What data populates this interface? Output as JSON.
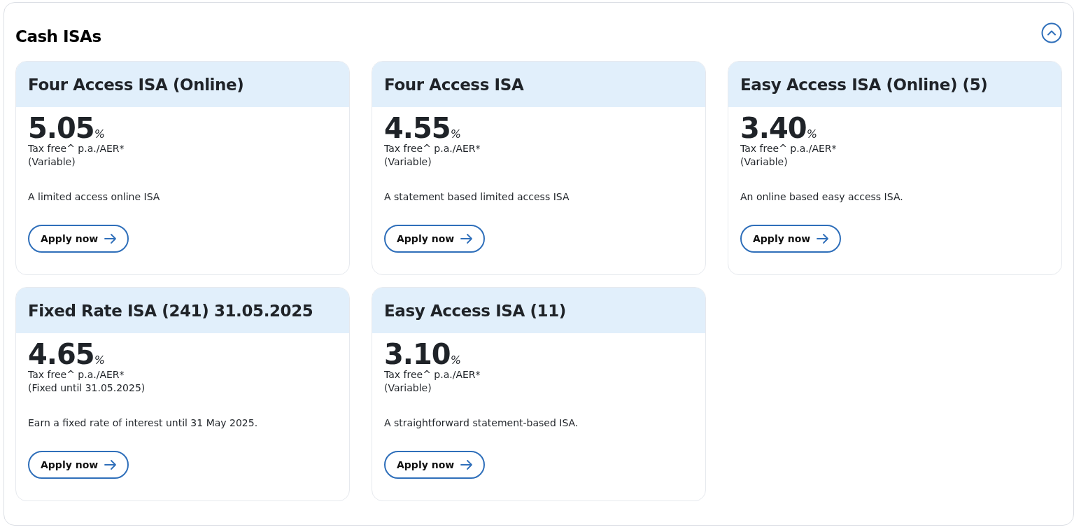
{
  "section": {
    "title": "Cash ISAs",
    "expanded": true
  },
  "products": [
    {
      "name": "Four Access ISA (Online)",
      "rate": "5.05",
      "unit": "%",
      "basis": "Tax free^ p.a./AER*",
      "rate_type": "(Variable)",
      "description": "A limited access online ISA",
      "button": "Apply now"
    },
    {
      "name": "Four Access ISA",
      "rate": "4.55",
      "unit": "%",
      "basis": "Tax free^ p.a./AER*",
      "rate_type": "(Variable)",
      "description": "A statement based limited access ISA",
      "button": "Apply now"
    },
    {
      "name": "Easy Access ISA (Online) (5)",
      "rate": "3.40",
      "unit": "%",
      "basis": "Tax free^ p.a./AER*",
      "rate_type": "(Variable)",
      "description": "An online based easy access ISA.",
      "button": "Apply now"
    },
    {
      "name": "Fixed Rate ISA (241) 31.05.2025",
      "rate": "4.65",
      "unit": "%",
      "basis": "Tax free^ p.a./AER*",
      "rate_type": "(Fixed until 31.05.2025)",
      "description": "Earn a fixed rate of interest until 31 May 2025.",
      "button": "Apply now"
    },
    {
      "name": "Easy Access ISA (11)",
      "rate": "3.10",
      "unit": "%",
      "basis": "Tax free^ p.a./AER*",
      "rate_type": "(Variable)",
      "description": "A straightforward statement-based ISA.",
      "button": "Apply now"
    }
  ]
}
